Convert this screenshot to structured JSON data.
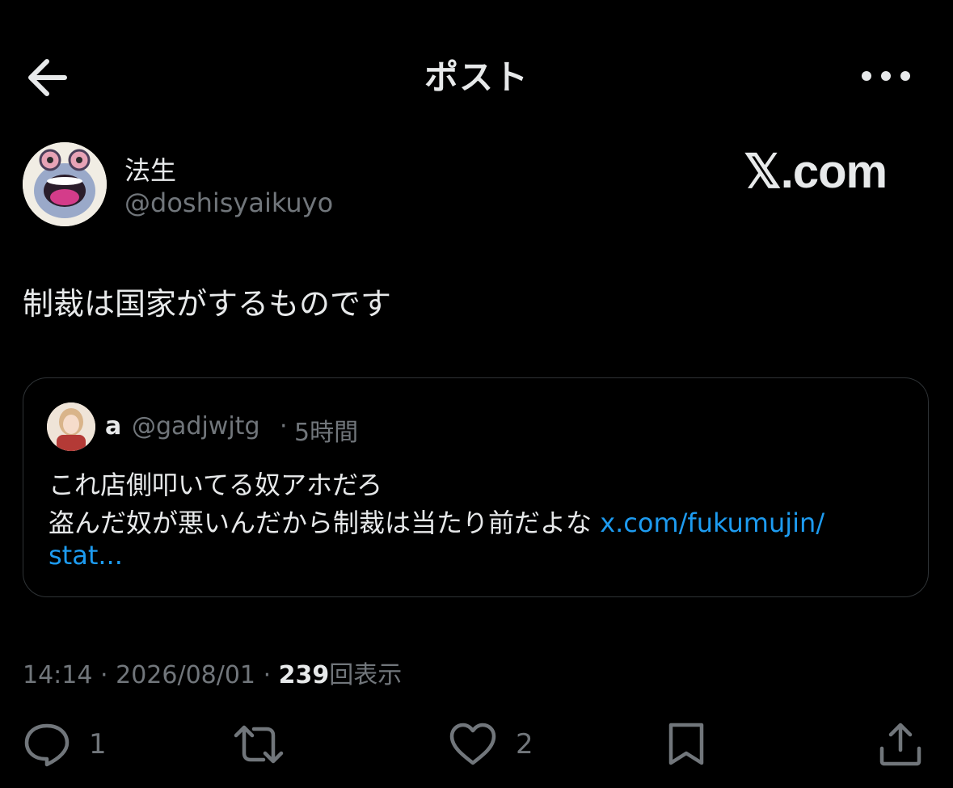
{
  "header": {
    "title": "ポスト"
  },
  "author": {
    "name": "法生",
    "handle": "@doshisyaikuyo"
  },
  "brand": "𝕏.com",
  "post": {
    "text": "制裁は国家がするものです"
  },
  "quote": {
    "name": "a",
    "handle": "@gadjwjtg",
    "separator": "·",
    "time": "5時間",
    "line1": "これ店側叩いてる奴アホだろ",
    "line2": "盗んだ奴が悪いんだから制裁は当たり前だよな",
    "link_part1": "x.com/fukumujin/",
    "link_part2": "stat..."
  },
  "meta": {
    "time": "14:14",
    "sep1": "·",
    "date": "2026/08/01",
    "sep2": "·",
    "views": "239",
    "views_label": "回表示"
  },
  "actions": {
    "reply_count": "1",
    "like_count": "2"
  },
  "colors": {
    "background": "#000000",
    "text": "#e7e9ea",
    "secondary": "#71767b",
    "link": "#1d9bf0",
    "border": "#2f3336"
  },
  "icons": [
    "back-arrow-icon",
    "more-icon",
    "reply-icon",
    "repost-icon",
    "like-icon",
    "bookmark-icon",
    "share-icon"
  ]
}
